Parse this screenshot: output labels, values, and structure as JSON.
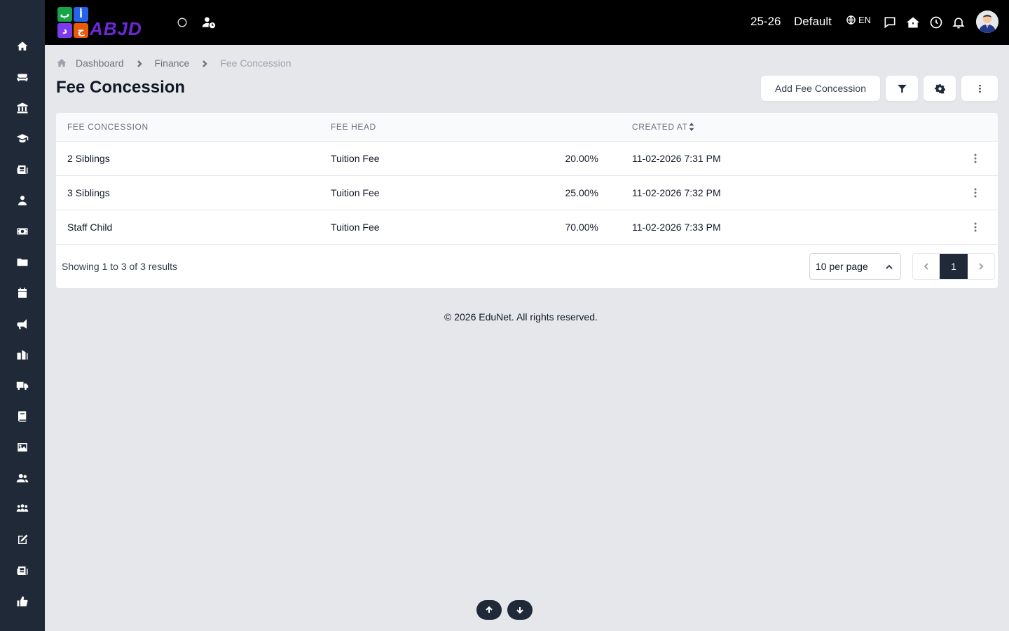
{
  "logo": {
    "glyphs": [
      "ب",
      "أ",
      "د",
      "ج"
    ],
    "word": "ABJD",
    "colors": [
      "#16a34a",
      "#2563eb",
      "#7c3aed",
      "#ea580c"
    ]
  },
  "topbar": {
    "session": "25-26",
    "profile": "Default",
    "language": "EN"
  },
  "breadcrumb": {
    "items": [
      "Dashboard",
      "Finance"
    ],
    "current": "Fee Concession"
  },
  "page": {
    "title": "Fee Concession",
    "add_button_label": "Add Fee Concession"
  },
  "table": {
    "columns": {
      "fee_concession": "FEE CONCESSION",
      "fee_head": "FEE HEAD",
      "created_at": "CREATED AT"
    },
    "rows": [
      {
        "name": "2 Siblings",
        "fee_head": "Tuition Fee",
        "percent": "20.00%",
        "created_at": "11-02-2026 7:31 PM"
      },
      {
        "name": "3 Siblings",
        "fee_head": "Tuition Fee",
        "percent": "25.00%",
        "created_at": "11-02-2026 7:32 PM"
      },
      {
        "name": "Staff Child",
        "fee_head": "Tuition Fee",
        "percent": "70.00%",
        "created_at": "11-02-2026 7:33 PM"
      }
    ]
  },
  "pagination": {
    "showing_text": "Showing 1 to 3 of 3 results",
    "per_page": "10 per page",
    "current_page": "1"
  },
  "footer": {
    "copyright": "© 2026 EduNet. All rights reserved."
  },
  "sidebar": {
    "icons": [
      "home-icon",
      "sofa-icon",
      "bank-icon",
      "graduate-icon",
      "news-icon",
      "user-tie-icon",
      "money-icon",
      "folder-icon",
      "calendar-icon",
      "megaphone-icon",
      "school-icon",
      "truck-icon",
      "book-icon",
      "image-icon",
      "users-icon",
      "people-group-icon",
      "edit-icon",
      "newspaper-icon",
      "thumbs-up-icon"
    ]
  },
  "colors": {
    "sidebar_bg": "#1f2937",
    "topbar_bg": "#000000",
    "page_bg": "#e5e7eb",
    "active_page": "#1f2937"
  }
}
